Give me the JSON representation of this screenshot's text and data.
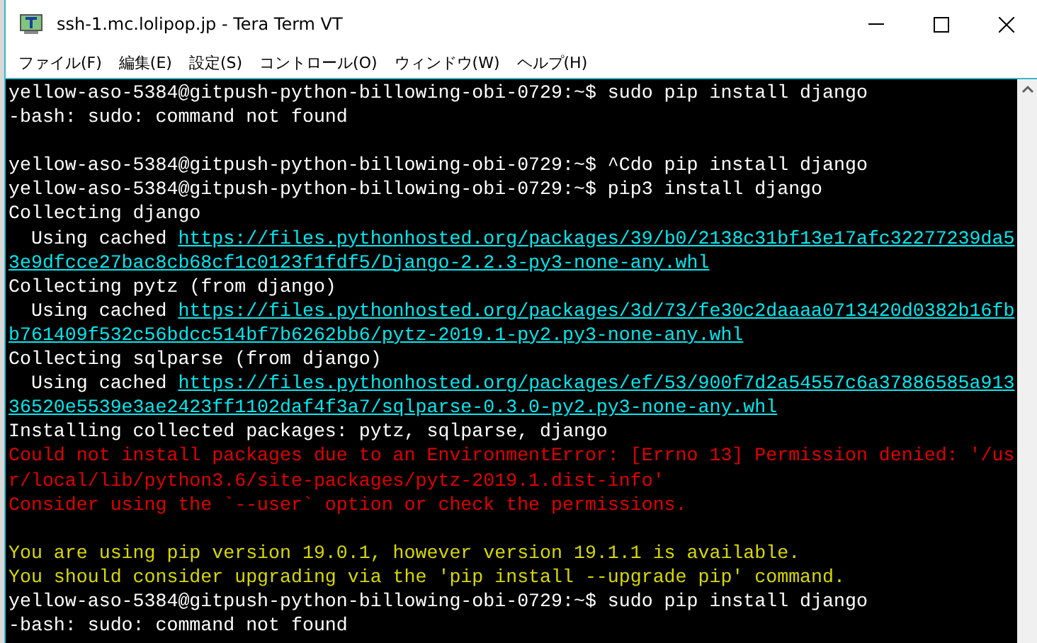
{
  "window": {
    "title": "ssh-1.mc.lolipop.jp - Tera Term VT"
  },
  "menu": [
    "ファイル(F)",
    "編集(E)",
    "設定(S)",
    "コントロール(O)",
    "ウィンドウ(W)",
    "ヘルプ(H)"
  ],
  "terminal": {
    "lines": [
      {
        "kind": "text",
        "color": "#ffffff",
        "text": "yellow-aso-5384@gitpush-python-billowing-obi-0729:~$ sudo pip install django"
      },
      {
        "kind": "text",
        "color": "#ffffff",
        "text": "-bash: sudo: command not found"
      },
      {
        "kind": "blank"
      },
      {
        "kind": "text",
        "color": "#ffffff",
        "text": "yellow-aso-5384@gitpush-python-billowing-obi-0729:~$ ^Cdo pip install django"
      },
      {
        "kind": "text",
        "color": "#ffffff",
        "text": "yellow-aso-5384@gitpush-python-billowing-obi-0729:~$ pip3 install django"
      },
      {
        "kind": "text",
        "color": "#ffffff",
        "text": "Collecting django"
      },
      {
        "kind": "link",
        "prefix": "  Using cached ",
        "url": "https://files.pythonhosted.org/packages/39/b0/2138c31bf13e17afc32277239da5"
      },
      {
        "kind": "link",
        "url": "3e9dfcce27bac8cb68cf1c0123f1fdf5/Django-2.2.3-py3-none-any.whl"
      },
      {
        "kind": "text",
        "color": "#ffffff",
        "text": "Collecting pytz (from django)"
      },
      {
        "kind": "link",
        "prefix": "  Using cached ",
        "url": "https://files.pythonhosted.org/packages/3d/73/fe30c2daaaa0713420d0382b16fb"
      },
      {
        "kind": "link",
        "url": "b761409f532c56bdcc514bf7b6262bb6/pytz-2019.1-py2.py3-none-any.whl"
      },
      {
        "kind": "text",
        "color": "#ffffff",
        "text": "Collecting sqlparse (from django)"
      },
      {
        "kind": "link",
        "prefix": "  Using cached ",
        "url": "https://files.pythonhosted.org/packages/ef/53/900f7d2a54557c6a37886585a913"
      },
      {
        "kind": "link",
        "url": "36520e5539e3ae2423ff1102daf4f3a7/sqlparse-0.3.0-py2.py3-none-any.whl"
      },
      {
        "kind": "text",
        "color": "#ffffff",
        "text": "Installing collected packages: pytz, sqlparse, django"
      },
      {
        "kind": "text",
        "color": "#e00000",
        "text": "Could not install packages due to an EnvironmentError: [Errno 13] Permission denied: '/us"
      },
      {
        "kind": "text",
        "color": "#e00000",
        "text": "r/local/lib/python3.6/site-packages/pytz-2019.1.dist-info'"
      },
      {
        "kind": "text",
        "color": "#e00000",
        "text": "Consider using the `--user` option or check the permissions."
      },
      {
        "kind": "blank"
      },
      {
        "kind": "text",
        "color": "#d8d800",
        "text": "You are using pip version 19.0.1, however version 19.1.1 is available."
      },
      {
        "kind": "text",
        "color": "#d8d800",
        "text": "You should consider upgrading via the 'pip install --upgrade pip' command."
      },
      {
        "kind": "text",
        "color": "#ffffff",
        "text": "yellow-aso-5384@gitpush-python-billowing-obi-0729:~$ sudo pip install django"
      },
      {
        "kind": "text",
        "color": "#ffffff",
        "text": "-bash: sudo: command not found"
      }
    ]
  }
}
